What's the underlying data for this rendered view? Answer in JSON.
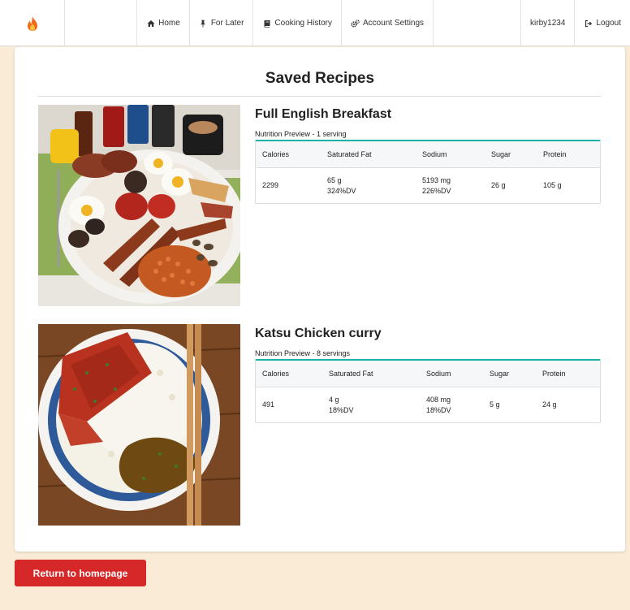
{
  "nav": {
    "brand_icon": "flame-icon",
    "home_label": "Home",
    "for_later_label": "For Later",
    "history_label": "Cooking History",
    "settings_label": "Account Settings",
    "username": "kirby1234",
    "logout_label": "Logout"
  },
  "page": {
    "title": "Saved Recipes",
    "return_label": "Return to homepage"
  },
  "colors": {
    "accent": "#19b3a6",
    "button": "#d62828",
    "background": "#faebd7"
  },
  "headers": [
    "Calories",
    "Saturated Fat",
    "Sodium",
    "Sugar",
    "Protein"
  ],
  "recipes": [
    {
      "title": "Full English Breakfast",
      "preview": "Nutrition Preview - 1 serving",
      "calories": "2299",
      "sat_fat": "65 g",
      "sat_fat_dv": "324%DV",
      "sodium": "5193 mg",
      "sodium_dv": "226%DV",
      "sugar": "26 g",
      "protein": "105 g"
    },
    {
      "title": "Katsu Chicken curry",
      "preview": "Nutrition Preview - 8 servings",
      "calories": "491",
      "sat_fat": "4 g",
      "sat_fat_dv": "18%DV",
      "sodium": "408 mg",
      "sodium_dv": "18%DV",
      "sugar": "5 g",
      "protein": "24 g"
    }
  ]
}
